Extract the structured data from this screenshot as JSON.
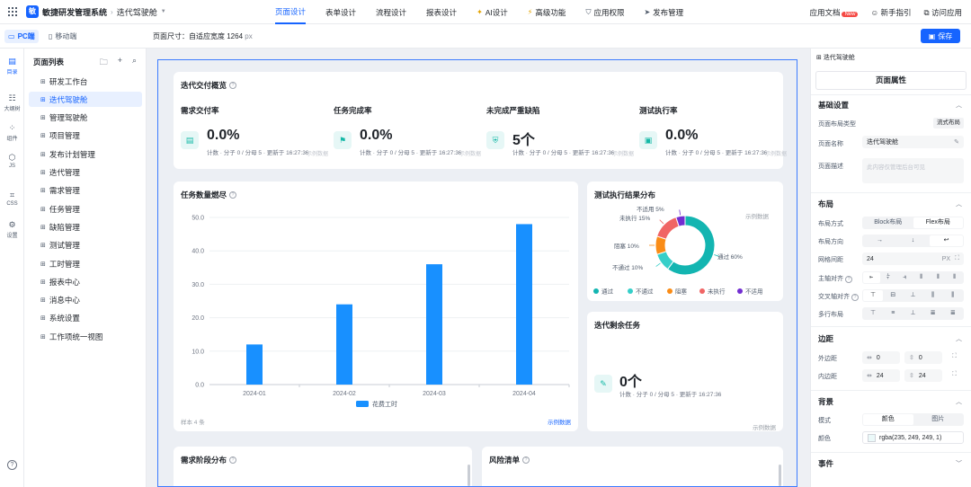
{
  "app": {
    "name": "敏捷研发管理系统",
    "logo_text": "敏",
    "breadcrumb": "迭代驾驶舱"
  },
  "nav": [
    {
      "label": "页面设计",
      "icon": "",
      "active": true
    },
    {
      "label": "表单设计",
      "icon": ""
    },
    {
      "label": "流程设计",
      "icon": ""
    },
    {
      "label": "报表设计",
      "icon": ""
    },
    {
      "label": "AI设计",
      "icon": "sparkle-icon"
    },
    {
      "label": "高级功能",
      "icon": "wand-icon"
    },
    {
      "label": "应用权限",
      "icon": "shield-icon"
    },
    {
      "label": "发布管理",
      "icon": "send-icon"
    }
  ],
  "top_right": {
    "docs": "应用文档",
    "new_badge": "New",
    "guide": "新手指引",
    "visit": "访问应用"
  },
  "toolbar": {
    "pc_label": "PC端",
    "mobile_label": "移动端",
    "page_size_label": "页面尺寸：自适应宽度 1264",
    "page_size_unit": "px",
    "save_label": "保存"
  },
  "rail": [
    {
      "label": "目录",
      "icon": "catalog-icon",
      "active": true
    },
    {
      "label": "大纲树",
      "icon": "outline-tree-icon"
    },
    {
      "label": "组件",
      "icon": "components-icon"
    },
    {
      "label": "JS",
      "icon": "js-icon"
    },
    {
      "label": "CSS",
      "icon": "css-icon"
    },
    {
      "label": "设置",
      "icon": "settings-icon"
    }
  ],
  "page_list": {
    "title": "页面列表",
    "items": [
      "研发工作台",
      "迭代驾驶舱",
      "管理驾驶舱",
      "项目管理",
      "发布计划管理",
      "迭代管理",
      "需求管理",
      "任务管理",
      "缺陷管理",
      "测试管理",
      "工时管理",
      "报表中心",
      "消息中心",
      "系统设置",
      "工作项统一视图"
    ],
    "active_index": 1
  },
  "overview": {
    "title": "迭代交付概览",
    "metrics": [
      {
        "label": "需求交付率",
        "value": "0.0%",
        "sub": "计数 · 分子 0 / 分母 5 · 更新于 16:27:36",
        "demo": "示例数据",
        "icon": "doc-chart-icon"
      },
      {
        "label": "任务完成率",
        "value": "0.0%",
        "sub": "计数 · 分子 0 / 分母 5 · 更新于 16:27:36",
        "demo": "示例数据",
        "icon": "flag-icon"
      },
      {
        "label": "未完成严重缺陷",
        "value": "5个",
        "sub": "计数 · 分子 0 / 分母 5 · 更新于 16:27:36",
        "demo": "示例数据",
        "icon": "shield-check-icon"
      },
      {
        "label": "测试执行率",
        "value": "0.0%",
        "sub": "计数 · 分子 0 / 分母 5 · 更新于 16:27:36",
        "demo": "示例数据",
        "icon": "case-icon"
      }
    ]
  },
  "burndown": {
    "title": "任务数量燃尽",
    "sample_count": "样本 4 条",
    "demo": "示例数据"
  },
  "test_result": {
    "title": "测试执行结果分布",
    "demo": "示例数据"
  },
  "remaining": {
    "title": "迭代剩余任务",
    "value": "0个",
    "sub": "计数 · 分子 0 / 分母 5 · 更新于 16:27:36",
    "demo": "示例数据"
  },
  "req_stage": {
    "title": "需求阶段分布"
  },
  "risk": {
    "title": "风险清单"
  },
  "chart_data": [
    {
      "type": "bar",
      "categories": [
        "2024-01",
        "2024-02",
        "2024-03",
        "2024-04"
      ],
      "series": [
        {
          "name": "花费工时",
          "values": [
            12,
            24,
            36,
            48
          ]
        }
      ],
      "ylim": [
        0,
        50
      ],
      "yticks": [
        "0.0",
        "10.0",
        "20.0",
        "30.0",
        "40.0",
        "50.0"
      ],
      "grid": true,
      "legend": "bottom",
      "color": "#1890ff"
    },
    {
      "type": "pie",
      "donut": true,
      "slices": [
        {
          "name": "通过",
          "value": 60,
          "label": "通过 60%",
          "color": "#13b5b1"
        },
        {
          "name": "不通过",
          "value": 10,
          "label": "不通过 10%",
          "color": "#36cfc9"
        },
        {
          "name": "阻塞",
          "value": 10,
          "label": "阻塞 10%",
          "color": "#fa8c16"
        },
        {
          "name": "未执行",
          "value": 15,
          "label": "未执行 15%",
          "color": "#f06565"
        },
        {
          "name": "不适用",
          "value": 5,
          "label": "不适用 5%",
          "color": "#722ed1"
        }
      ],
      "legend": "bottom"
    }
  ],
  "props": {
    "header": "迭代驾驶舱",
    "tab": "页面属性",
    "basic_title": "基础设置",
    "layout_type_label": "页面布局类型",
    "layout_type_value": "流式布局",
    "page_name_label": "页面名称",
    "page_name_value": "迭代驾驶舱",
    "desc_label": "页面描述",
    "desc_placeholder": "此内容仅管理后台可见",
    "layout_title": "布局",
    "layout_mode_label": "布局方式",
    "layout_block": "Block布局",
    "layout_flex": "Flex布局",
    "direction_label": "布局方向",
    "gap_label": "网格间距",
    "gap_value": "24",
    "gap_unit": "PX",
    "main_axis_label": "主轴对齐",
    "cross_axis_label": "交叉轴对齐",
    "multi_line_label": "多行布局",
    "spacing_title": "边距",
    "margin_label": "外边距",
    "margin_x": "0",
    "margin_y": "0",
    "padding_label": "内边距",
    "padding_x": "24",
    "padding_y": "24",
    "bg_title": "背景",
    "bg_mode_label": "模式",
    "bg_color_opt": "颜色",
    "bg_image_opt": "图片",
    "bg_color_label": "颜色",
    "bg_color_value": "rgba(235, 249, 249, 1)",
    "events_title": "事件"
  }
}
